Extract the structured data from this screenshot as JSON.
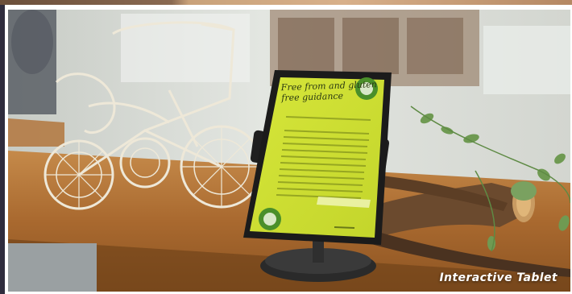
{
  "photo": {
    "caption": "Interactive Tablet",
    "tablet_screen_title": "Free from and gluten free guidance"
  }
}
